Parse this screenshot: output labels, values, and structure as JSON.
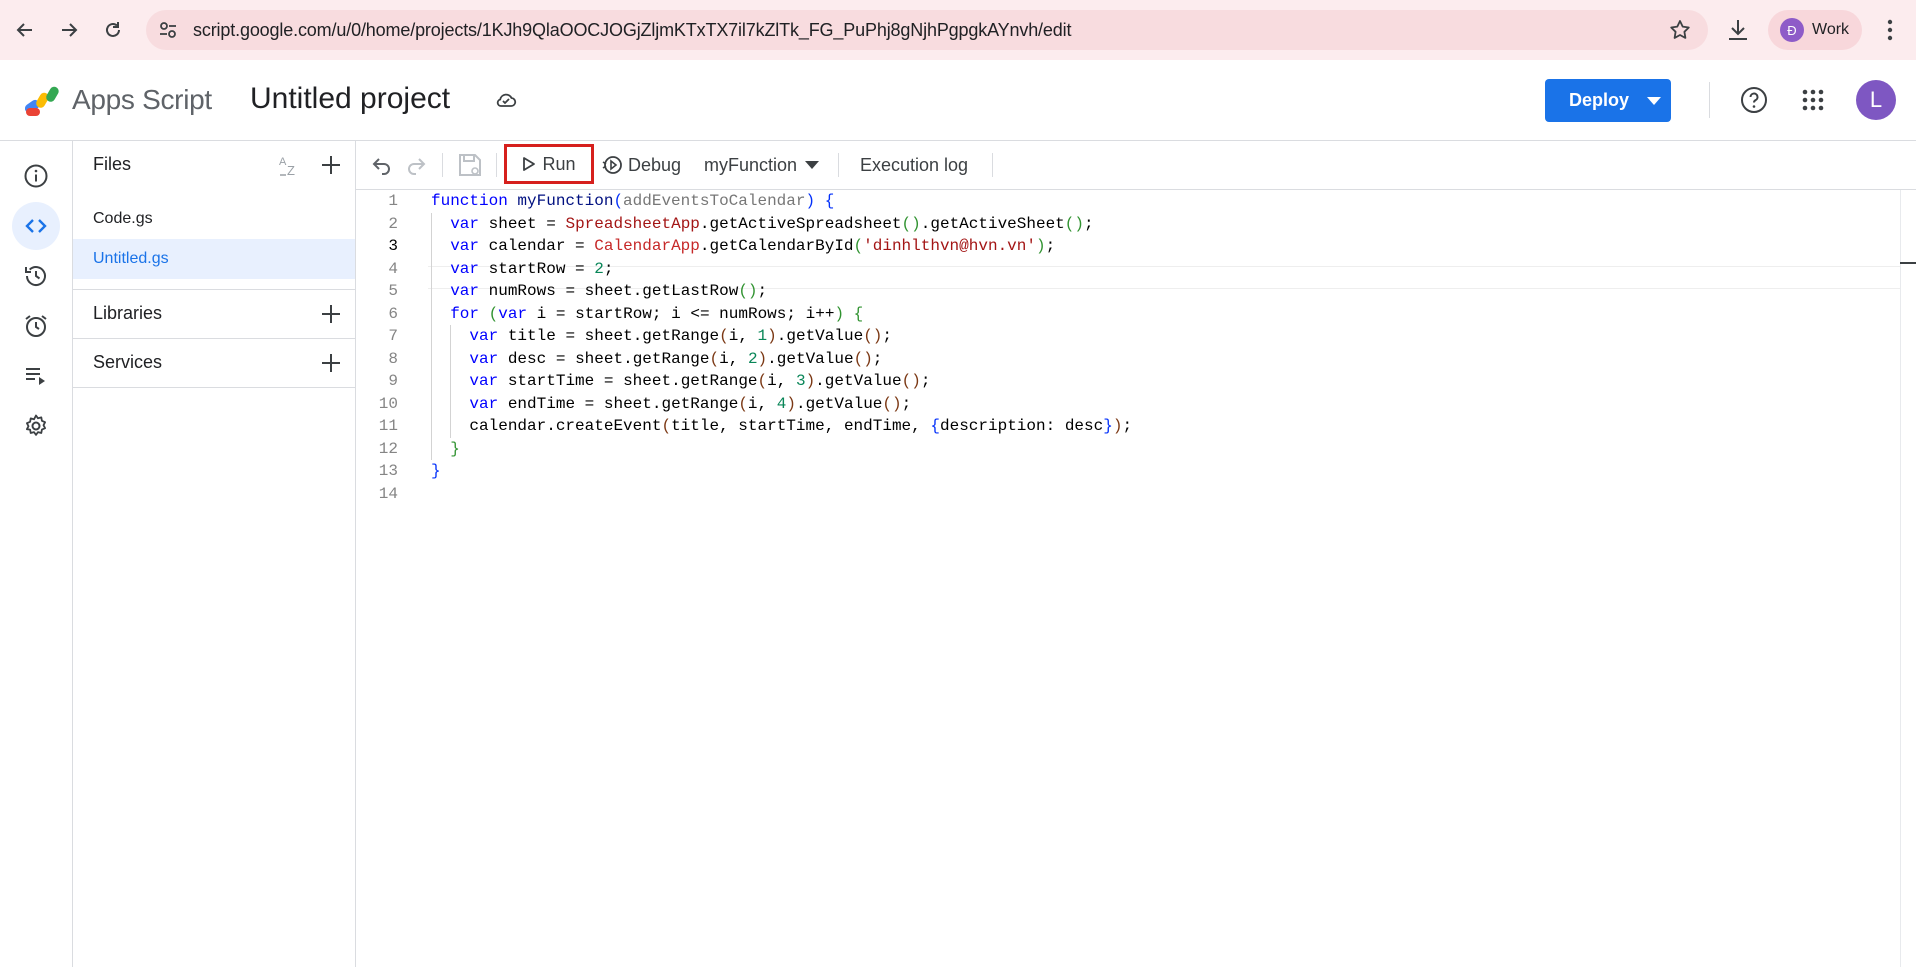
{
  "browser": {
    "url": "script.google.com/u/0/home/projects/1KJh9QlaOOCJOGjZljmKTxTX7il7kZlTk_FG_PuPhj8gNjhPgpgkAYnvh/edit",
    "profile_initial": "Đ",
    "profile_label": "Work"
  },
  "header": {
    "product_name": "Apps Script",
    "project_title": "Untitled project",
    "deploy_label": "Deploy",
    "account_initial": "L"
  },
  "files_panel": {
    "files_title": "Files",
    "files": [
      "Code.gs",
      "Untitled.gs"
    ],
    "active_file": "Untitled.gs",
    "libraries_title": "Libraries",
    "services_title": "Services"
  },
  "toolbar": {
    "run_label": "Run",
    "debug_label": "Debug",
    "function_name": "myFunction",
    "execution_log_label": "Execution log"
  },
  "editor": {
    "current_line": 3,
    "lines": [
      "function myFunction(addEventsToCalendar) {",
      "  var sheet = SpreadsheetApp.getActiveSpreadsheet().getActiveSheet();",
      "  var calendar = CalendarApp.getCalendarById('dinhlthvn@hvn.vn');",
      "  var startRow = 2;",
      "  var numRows = sheet.getLastRow();",
      "  for (var i = startRow; i <= numRows; i++) {",
      "    var title = sheet.getRange(i, 1).getValue();",
      "    var desc = sheet.getRange(i, 2).getValue();",
      "    var startTime = sheet.getRange(i, 3).getValue();",
      "    var endTime = sheet.getRange(i, 4).getValue();",
      "    calendar.createEvent(title, startTime, endTime, {description: desc});",
      "  }",
      "}",
      ""
    ]
  },
  "colors": {
    "accent": "#1a73e8",
    "browser_bg": "#fcecee",
    "highlight_box": "#d6201d"
  }
}
